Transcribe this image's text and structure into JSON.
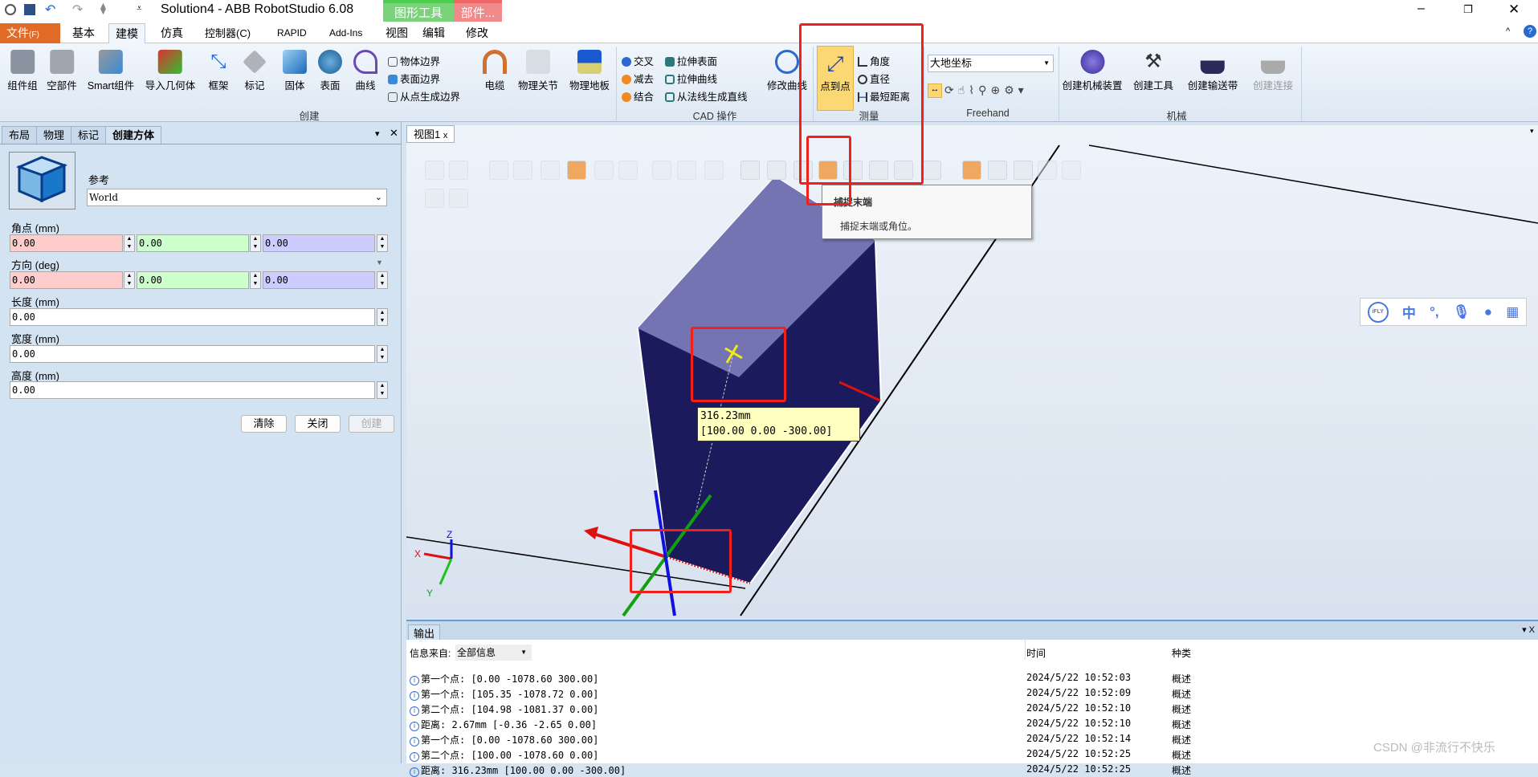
{
  "app": {
    "title": "Solution4 - ABB RobotStudio 6.08",
    "context_tabs": [
      {
        "label": "图形工具",
        "color": "#3cc43c"
      },
      {
        "label": "部件...",
        "color": "#f06464"
      }
    ],
    "window_controls": [
      "minimize",
      "restore",
      "close"
    ]
  },
  "tabs": [
    {
      "label": "文件",
      "shortcut": "(F)"
    },
    {
      "label": "基本"
    },
    {
      "label": "建模",
      "selected": true
    },
    {
      "label": "仿真"
    },
    {
      "label": "控制器(C)"
    },
    {
      "label": "RAPID"
    },
    {
      "label": "Add-Ins"
    },
    {
      "label": "视图"
    },
    {
      "label": "编辑"
    },
    {
      "label": "修改"
    }
  ],
  "ribbon": {
    "create": {
      "label": "创建",
      "items": [
        "组件组",
        "空部件",
        "Smart组件",
        "导入几何体",
        "框架",
        "标记",
        "固体",
        "表面",
        "曲线"
      ],
      "small": [
        "物体边界",
        "表面边界",
        "从点生成边界"
      ],
      "items2": [
        "电缆",
        "物理关节",
        "物理地板"
      ]
    },
    "cad": {
      "label": "CAD 操作",
      "col1": [
        "交叉",
        "减去",
        "结合"
      ],
      "col2": [
        "拉伸表面",
        "拉伸曲线",
        "从法线生成直线"
      ],
      "modify": "修改曲线"
    },
    "measure": {
      "label": "测量",
      "main": "点到点",
      "small": [
        "角度",
        "直径",
        "最短距离"
      ]
    },
    "freehand": {
      "label": "Freehand",
      "frame": "大地坐标"
    },
    "mechanism": {
      "label": "机械",
      "items": [
        "创建机械装置",
        "创建工具",
        "创建输送带",
        "创建连接"
      ]
    }
  },
  "left_panel": {
    "tabs": [
      "布局",
      "物理",
      "标记",
      "创建方体"
    ],
    "active_tab": "创建方体",
    "reference_label": "参考",
    "reference_value": "World",
    "corner_label": "角点 (mm)",
    "corner": [
      "0.00",
      "0.00",
      "0.00"
    ],
    "orientation_label": "方向 (deg)",
    "orientation": [
      "0.00",
      "0.00",
      "0.00"
    ],
    "length_label": "长度 (mm)",
    "length": "0.00",
    "width_label": "宽度 (mm)",
    "width": "0.00",
    "height_label": "高度 (mm)",
    "height": "0.00",
    "buttons": {
      "clear": "清除",
      "close": "关闭",
      "create": "创建"
    }
  },
  "viewport": {
    "tab": "视图1",
    "tooltip_title": "捕捉末端",
    "tooltip_text": "捕捉末端或角位。",
    "measure_label": "316.23mm",
    "measure_coords": "[100.00 0.00 -300.00]",
    "axes": {
      "x": "X",
      "y": "Y",
      "z": "Z"
    },
    "ime_bar": [
      "iFLY",
      "中",
      "°,",
      "mic",
      "user",
      "apps"
    ]
  },
  "output": {
    "tab": "输出",
    "source_label": "信息来自:",
    "source_value": "全部信息",
    "col_time": "时间",
    "col_type": "种类",
    "rows": [
      {
        "msg": "第一个点: [0.00 -1078.60 300.00]",
        "time": "2024/5/22 10:52:03",
        "type": "概述"
      },
      {
        "msg": "第一个点: [105.35 -1078.72 0.00]",
        "time": "2024/5/22 10:52:09",
        "type": "概述"
      },
      {
        "msg": "第二个点: [104.98 -1081.37 0.00]",
        "time": "2024/5/22 10:52:10",
        "type": "概述"
      },
      {
        "msg": "距离: 2.67mm [-0.36 -2.65 0.00]",
        "time": "2024/5/22 10:52:10",
        "type": "概述"
      },
      {
        "msg": "第一个点: [0.00 -1078.60 300.00]",
        "time": "2024/5/22 10:52:14",
        "type": "概述"
      },
      {
        "msg": "第二个点: [100.00 -1078.60 0.00]",
        "time": "2024/5/22 10:52:25",
        "type": "概述"
      },
      {
        "msg": "距离: 316.23mm [100.00 0.00 -300.00]",
        "time": "2024/5/22 10:52:25",
        "type": "概述"
      }
    ]
  },
  "watermark": "CSDN @非流行不快乐"
}
